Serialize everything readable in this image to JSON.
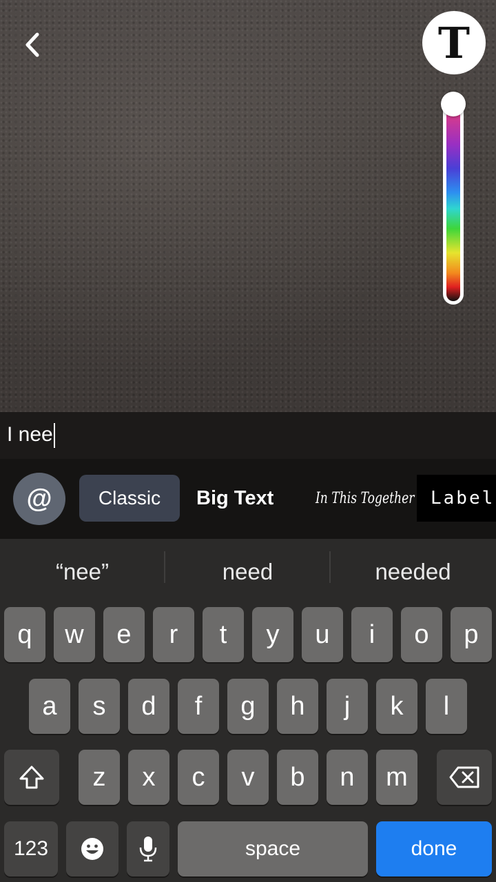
{
  "header": {
    "back_icon": "chevron-left-icon",
    "text_tool_label": "T"
  },
  "caption": {
    "text": "I nee"
  },
  "styles": {
    "mention_label": "@",
    "options": [
      "Classic",
      "Big Text",
      "In This Together",
      "Label"
    ],
    "selected": "Classic"
  },
  "keyboard": {
    "suggestions": [
      "“nee”",
      "need",
      "needed"
    ],
    "row1": [
      "q",
      "w",
      "e",
      "r",
      "t",
      "y",
      "u",
      "i",
      "o",
      "p"
    ],
    "row2": [
      "a",
      "s",
      "d",
      "f",
      "g",
      "h",
      "j",
      "k",
      "l"
    ],
    "row3": [
      "z",
      "x",
      "c",
      "v",
      "b",
      "n",
      "m"
    ],
    "numbers_label": "123",
    "space_label": "space",
    "done_label": "done"
  },
  "colors": {
    "accent_done": "#1e7ef0",
    "selected_style_bg": "#3c4250",
    "mention_bg": "#5f6672"
  }
}
